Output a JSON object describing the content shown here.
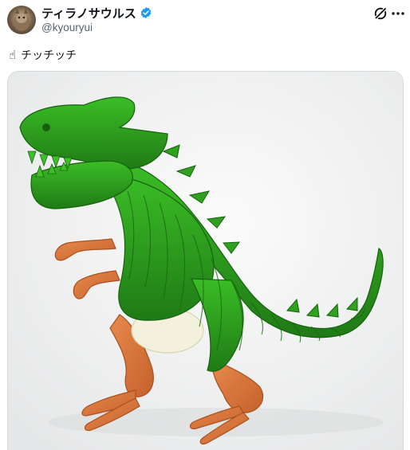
{
  "post": {
    "author": {
      "display_name": "ティラノサウルス",
      "handle": "@kyouryui",
      "verified": true
    },
    "text": "チッチッチ",
    "text_emoji": "☝",
    "actions": {
      "grok_icon": "grok-icon",
      "more_icon": "more-horizontal-icon"
    },
    "media": {
      "kind": "photo",
      "subject_icon": "pepper-dinosaur-photo"
    }
  },
  "colors": {
    "pepper_green": "#2e9f1f",
    "pepper_dark": "#1f6f14",
    "sausage": "#d9743a",
    "onion": "#f3f1dc",
    "verified_blue": "#1d9bf0",
    "secondary_text": "#536471"
  }
}
